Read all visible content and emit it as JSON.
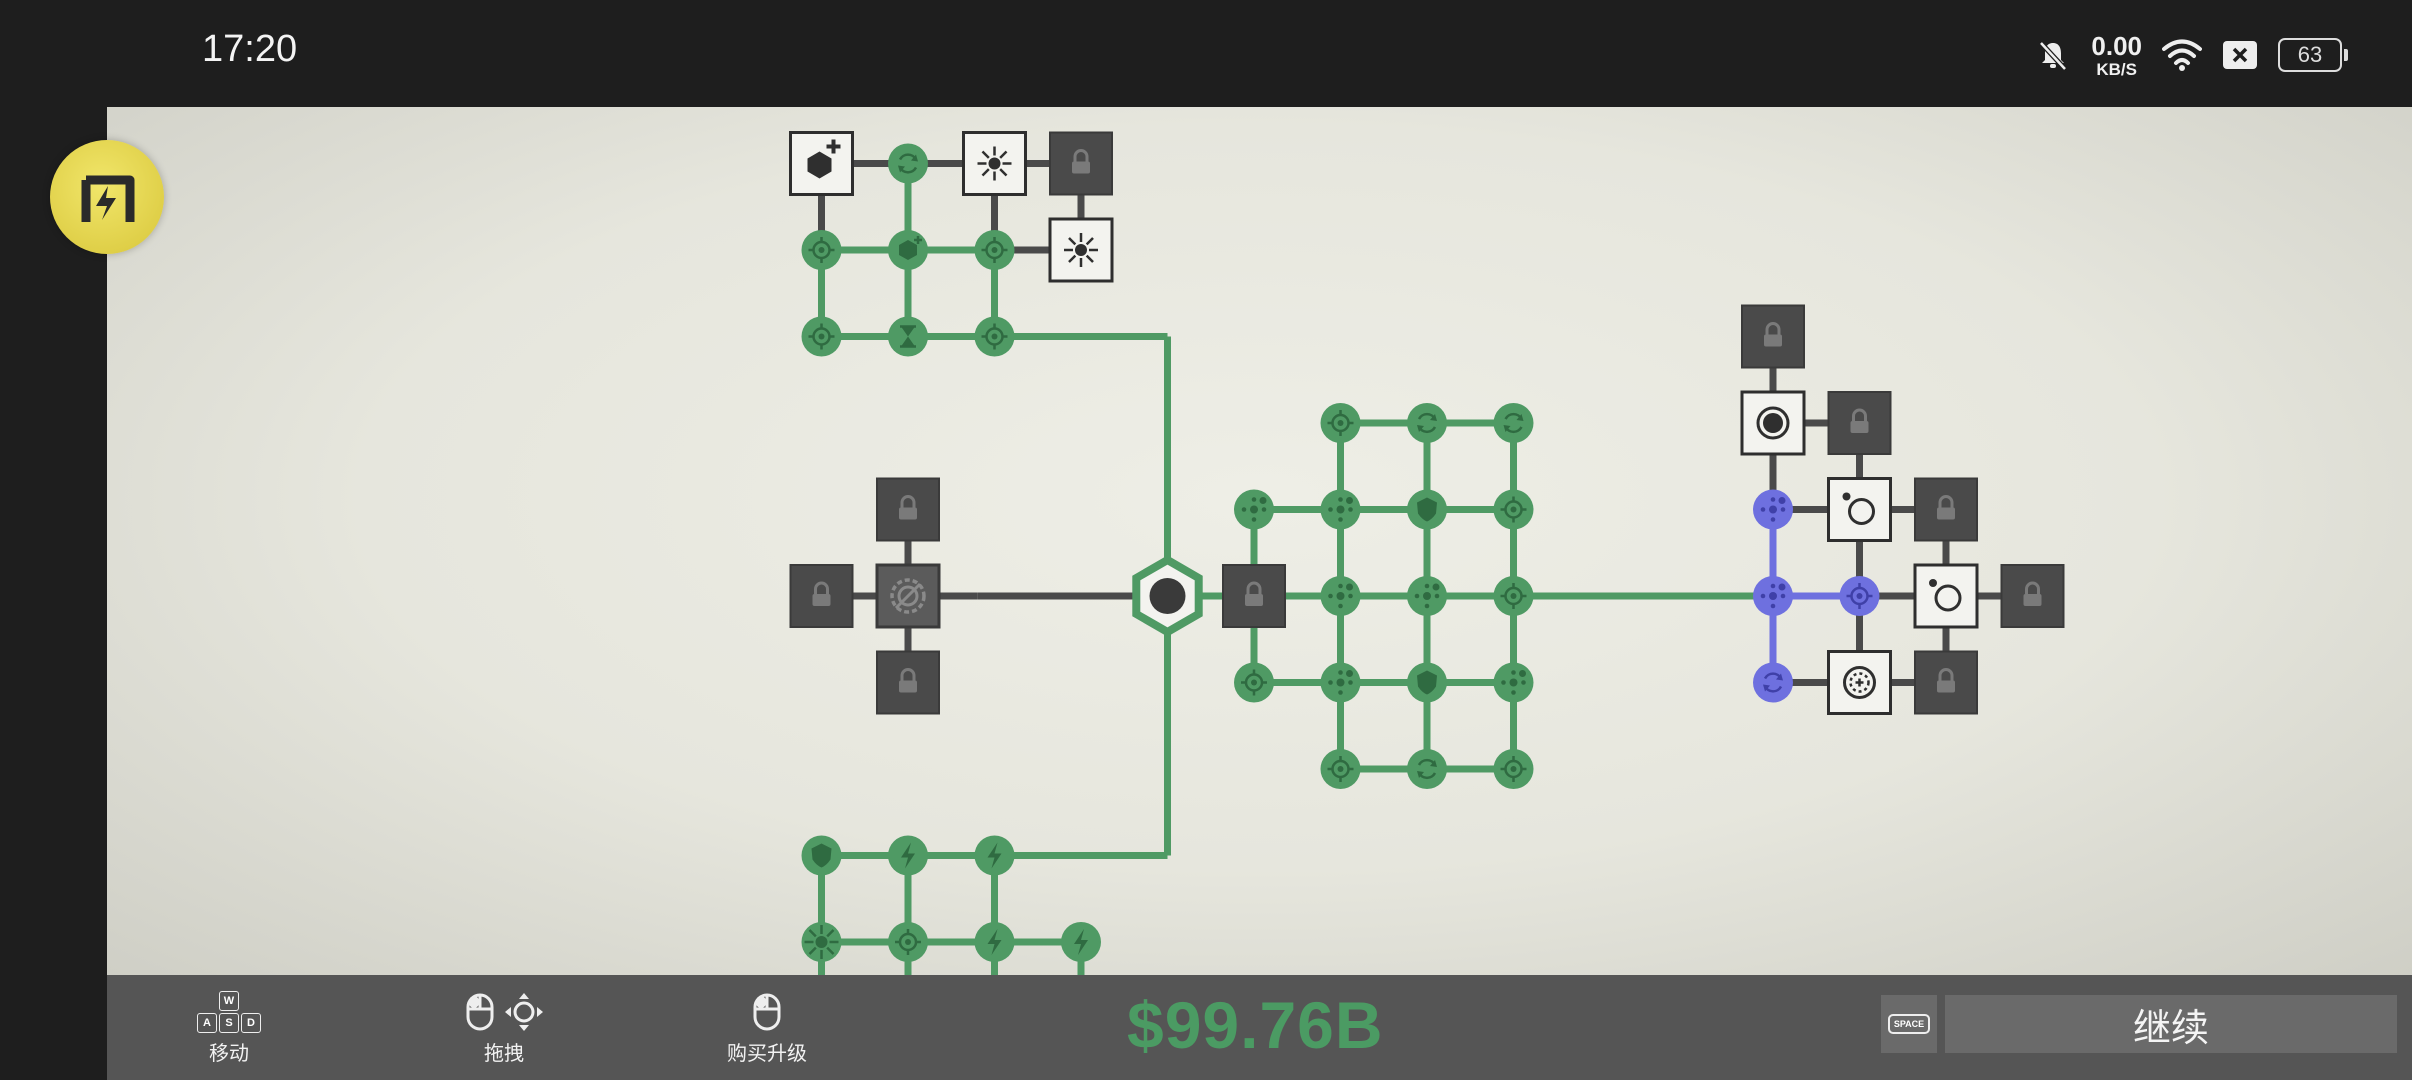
{
  "status_bar": {
    "time": "17:20",
    "net_speed_value": "0.00",
    "net_speed_unit": "KB/S",
    "battery_level": "63"
  },
  "game": {
    "colors": {
      "owned": "#4f9a64",
      "special": "#6e70df",
      "locked": "#4a4a4a",
      "available": "#f3f3ef",
      "background": "#e6e6dd"
    },
    "nodes": [
      {
        "c": 0,
        "r": 0,
        "kind": "lock"
      },
      {
        "c": -4,
        "r": 0,
        "kind": "box-gray",
        "icon": "cog"
      },
      {
        "c": -5,
        "r": 0,
        "kind": "lock"
      },
      {
        "c": -4,
        "r": -1,
        "kind": "lock"
      },
      {
        "c": -4,
        "r": 1,
        "kind": "lock"
      },
      {
        "c": -5,
        "r": -5,
        "kind": "available",
        "icon": "hex-plus"
      },
      {
        "c": -4,
        "r": -5,
        "kind": "owned",
        "icon": "cycle"
      },
      {
        "c": -3,
        "r": -5,
        "kind": "available",
        "icon": "burst"
      },
      {
        "c": -2,
        "r": -5,
        "kind": "lock"
      },
      {
        "c": -2,
        "r": -4,
        "kind": "available",
        "icon": "burst"
      },
      {
        "c": -5,
        "r": -4,
        "kind": "owned",
        "icon": "target"
      },
      {
        "c": -4,
        "r": -4,
        "kind": "owned",
        "icon": "hex"
      },
      {
        "c": -3,
        "r": -4,
        "kind": "owned",
        "icon": "target"
      },
      {
        "c": -5,
        "r": -3,
        "kind": "owned",
        "icon": "target"
      },
      {
        "c": -4,
        "r": -3,
        "kind": "owned",
        "icon": "hourglass"
      },
      {
        "c": -3,
        "r": -3,
        "kind": "owned",
        "icon": "target"
      },
      {
        "c": 1,
        "r": -2,
        "kind": "owned",
        "icon": "target"
      },
      {
        "c": 2,
        "r": -2,
        "kind": "owned",
        "icon": "cycle"
      },
      {
        "c": 3,
        "r": -2,
        "kind": "owned",
        "icon": "cycle"
      },
      {
        "c": 0,
        "r": -1,
        "kind": "owned",
        "icon": "dots"
      },
      {
        "c": 1,
        "r": -1,
        "kind": "owned",
        "icon": "dots"
      },
      {
        "c": 2,
        "r": -1,
        "kind": "owned",
        "icon": "shield"
      },
      {
        "c": 3,
        "r": -1,
        "kind": "owned",
        "icon": "target"
      },
      {
        "c": 1,
        "r": 0,
        "kind": "owned",
        "icon": "dots"
      },
      {
        "c": 2,
        "r": 0,
        "kind": "owned",
        "icon": "dots"
      },
      {
        "c": 3,
        "r": 0,
        "kind": "owned",
        "icon": "target"
      },
      {
        "c": 0,
        "r": 1,
        "kind": "owned",
        "icon": "target"
      },
      {
        "c": 1,
        "r": 1,
        "kind": "owned",
        "icon": "dots"
      },
      {
        "c": 2,
        "r": 1,
        "kind": "owned",
        "icon": "shield"
      },
      {
        "c": 3,
        "r": 1,
        "kind": "owned",
        "icon": "dots"
      },
      {
        "c": 1,
        "r": 2,
        "kind": "owned",
        "icon": "target"
      },
      {
        "c": 2,
        "r": 2,
        "kind": "owned",
        "icon": "cycle"
      },
      {
        "c": 3,
        "r": 2,
        "kind": "owned",
        "icon": "target"
      },
      {
        "c": -5,
        "r": 3,
        "kind": "owned",
        "icon": "shield"
      },
      {
        "c": -4,
        "r": 3,
        "kind": "owned",
        "icon": "bolt"
      },
      {
        "c": -3,
        "r": 3,
        "kind": "owned",
        "icon": "bolt"
      },
      {
        "c": -5,
        "r": 4,
        "kind": "owned",
        "icon": "burst"
      },
      {
        "c": -4,
        "r": 4,
        "kind": "owned",
        "icon": "target"
      },
      {
        "c": -3,
        "r": 4,
        "kind": "owned",
        "icon": "bolt"
      },
      {
        "c": -2,
        "r": 4,
        "kind": "owned",
        "icon": "bolt"
      },
      {
        "c": 6,
        "r": -3,
        "kind": "lock"
      },
      {
        "c": 6,
        "r": -2,
        "kind": "available",
        "icon": "ring-dot"
      },
      {
        "c": 7,
        "r": -2,
        "kind": "lock"
      },
      {
        "c": 6,
        "r": -1,
        "kind": "special",
        "icon": "dots"
      },
      {
        "c": 7,
        "r": -1,
        "kind": "available",
        "icon": "ring-small"
      },
      {
        "c": 8,
        "r": -1,
        "kind": "lock"
      },
      {
        "c": 6,
        "r": 0,
        "kind": "special",
        "icon": "dots"
      },
      {
        "c": 7,
        "r": 0,
        "kind": "special",
        "icon": "target"
      },
      {
        "c": 8,
        "r": 0,
        "kind": "available",
        "icon": "ring-small"
      },
      {
        "c": 9,
        "r": 0,
        "kind": "lock"
      },
      {
        "c": 6,
        "r": 1,
        "kind": "special",
        "icon": "cycle"
      },
      {
        "c": 7,
        "r": 1,
        "kind": "available",
        "icon": "crosshair"
      },
      {
        "c": 8,
        "r": 1,
        "kind": "lock"
      }
    ],
    "edges": [
      [
        "-4,0",
        "-5,0",
        "gray"
      ],
      [
        "-4,0",
        "-4,-1",
        "gray"
      ],
      [
        "-4,0",
        "-4,1",
        "gray"
      ],
      [
        "-4,0",
        "-3.2,0",
        "gray"
      ],
      [
        "-3.2,0",
        "-1,0",
        "gray"
      ],
      [
        "-1,0",
        "0,0",
        "green"
      ],
      [
        "-1,0",
        "-1,-3",
        "green"
      ],
      [
        "-1,0",
        "-1,3",
        "green"
      ],
      [
        "-5,-5",
        "-4,-5",
        "gray"
      ],
      [
        "-4,-5",
        "-3,-5",
        "gray"
      ],
      [
        "-3,-5",
        "-2,-5",
        "gray"
      ],
      [
        "-5,-5",
        "-5,-4",
        "gray"
      ],
      [
        "-3,-5",
        "-3,-4",
        "gray"
      ],
      [
        "-2,-5",
        "-2,-4",
        "gray"
      ],
      [
        "-4,-5",
        "-4,-4",
        "green"
      ],
      [
        "-5,-4",
        "-4,-4",
        "green"
      ],
      [
        "-4,-4",
        "-3,-4",
        "green"
      ],
      [
        "-3,-4",
        "-2,-4",
        "gray"
      ],
      [
        "-5,-4",
        "-5,-3",
        "green"
      ],
      [
        "-4,-4",
        "-4,-3",
        "green"
      ],
      [
        "-3,-4",
        "-3,-3",
        "green"
      ],
      [
        "-5,-3",
        "-4,-3",
        "green"
      ],
      [
        "-4,-3",
        "-3,-3",
        "green"
      ],
      [
        "-4,-3",
        "-1,-3",
        "green"
      ],
      [
        "1,-2",
        "2,-2",
        "green"
      ],
      [
        "2,-2",
        "3,-2",
        "green"
      ],
      [
        "1,-2",
        "1,-1",
        "green"
      ],
      [
        "2,-2",
        "2,-1",
        "green"
      ],
      [
        "3,-2",
        "3,-1",
        "green"
      ],
      [
        "0,-1",
        "1,-1",
        "green"
      ],
      [
        "1,-1",
        "2,-1",
        "green"
      ],
      [
        "2,-1",
        "3,-1",
        "green"
      ],
      [
        "0,-1",
        "0,0",
        "green"
      ],
      [
        "1,-1",
        "1,0",
        "green"
      ],
      [
        "2,-1",
        "2,0",
        "green"
      ],
      [
        "3,-1",
        "3,0",
        "green"
      ],
      [
        "0,0",
        "1,0",
        "green"
      ],
      [
        "1,0",
        "2,0",
        "green"
      ],
      [
        "2,0",
        "3,0",
        "green"
      ],
      [
        "0,0",
        "0,1",
        "green"
      ],
      [
        "1,0",
        "1,1",
        "green"
      ],
      [
        "2,0",
        "2,1",
        "green"
      ],
      [
        "3,0",
        "3,1",
        "green"
      ],
      [
        "0,1",
        "1,1",
        "green"
      ],
      [
        "1,1",
        "2,1",
        "green"
      ],
      [
        "2,1",
        "3,1",
        "green"
      ],
      [
        "1,1",
        "1,2",
        "green"
      ],
      [
        "2,1",
        "2,2",
        "green"
      ],
      [
        "3,1",
        "3,2",
        "green"
      ],
      [
        "1,2",
        "2,2",
        "green"
      ],
      [
        "2,2",
        "3,2",
        "green"
      ],
      [
        "3,0",
        "6,0",
        "green"
      ],
      [
        "-5,3",
        "-4,3",
        "green"
      ],
      [
        "-4,3",
        "-3,3",
        "green"
      ],
      [
        "-5,3",
        "-5,4",
        "green"
      ],
      [
        "-4,3",
        "-4,4",
        "green"
      ],
      [
        "-3,3",
        "-3,4",
        "green"
      ],
      [
        "-5,4",
        "-4,4",
        "green"
      ],
      [
        "-4,4",
        "-3,4",
        "green"
      ],
      [
        "-3,4",
        "-2,4",
        "green"
      ],
      [
        "-4,3",
        "-1,3",
        "green"
      ],
      [
        "6,-3",
        "6,-2",
        "gray"
      ],
      [
        "6,-2",
        "7,-2",
        "gray"
      ],
      [
        "6,-2",
        "6,-1",
        "gray"
      ],
      [
        "7,-2",
        "7,-1",
        "gray"
      ],
      [
        "6,-1",
        "7,-1",
        "gray"
      ],
      [
        "7,-1",
        "8,-1",
        "gray"
      ],
      [
        "7,-1",
        "7,0",
        "gray"
      ],
      [
        "8,-1",
        "8,0",
        "gray"
      ],
      [
        "6,-1",
        "6,0",
        "purple"
      ],
      [
        "6,0",
        "7,0",
        "purple"
      ],
      [
        "6,0",
        "6,1",
        "purple"
      ],
      [
        "7,0",
        "8,0",
        "gray"
      ],
      [
        "8,0",
        "9,0",
        "gray"
      ],
      [
        "7,0",
        "7,1",
        "gray"
      ],
      [
        "8,0",
        "8,1",
        "gray"
      ],
      [
        "6,1",
        "7,1",
        "gray"
      ],
      [
        "7,1",
        "8,1",
        "gray"
      ]
    ]
  },
  "bottom_bar": {
    "keys_wasd": [
      "W",
      "A",
      "S",
      "D"
    ],
    "move_label": "移动",
    "drag_label": "拖拽",
    "buy_label": "购买升级",
    "money": "$99.76B",
    "space_key": "SPACE",
    "continue_label": "继续"
  }
}
